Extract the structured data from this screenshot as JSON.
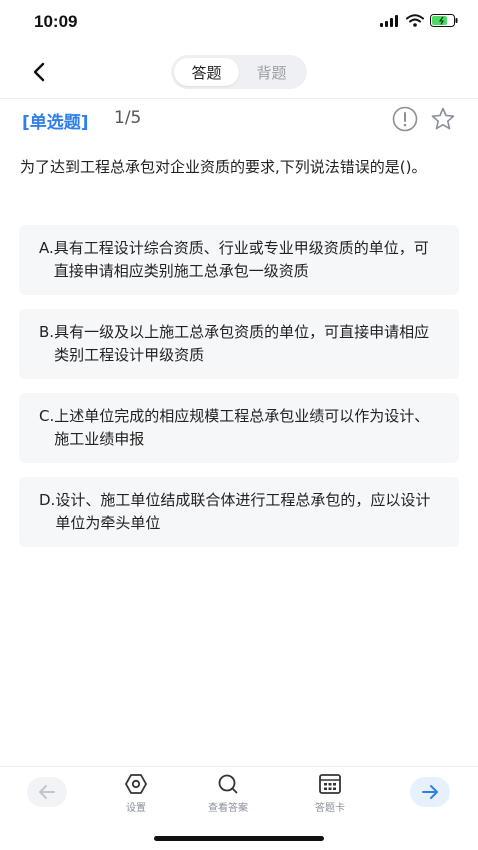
{
  "status_bar": {
    "time": "10:09"
  },
  "nav": {
    "tabs": [
      {
        "label": "答题",
        "active": true
      },
      {
        "label": "背题",
        "active": false
      }
    ]
  },
  "question": {
    "type_label": "[单选题]",
    "progress": "1/5",
    "stem": "为了达到工程总承包对企业资质的要求,下列说法错误的是()。",
    "options": [
      {
        "letter": "A.",
        "text": "具有工程设计综合资质、行业或专业甲级资质的单位，可直接申请相应类别施工总承包一级资质"
      },
      {
        "letter": "B.",
        "text": "具有一级及以上施工总承包资质的单位，可直接申请相应类别工程设计甲级资质"
      },
      {
        "letter": "C.",
        "text": "上述单位完成的相应规模工程总承包业绩可以作为设计、施工业绩申报"
      },
      {
        "letter": "D.",
        "text": "设计、施工单位结成联合体进行工程总承包的，应以设计单位为牵头单位"
      }
    ]
  },
  "toolbar": {
    "settings_label": "设置",
    "view_answer_label": "查看答案",
    "answer_card_label": "答题卡"
  },
  "colors": {
    "accent": "#2f7fe6",
    "option_bg": "#f6f7f9"
  },
  "icons": [
    "back-icon",
    "report-icon",
    "star-icon",
    "prev-arrow-icon",
    "settings-icon",
    "search-icon",
    "answer-card-icon",
    "next-arrow-icon"
  ]
}
